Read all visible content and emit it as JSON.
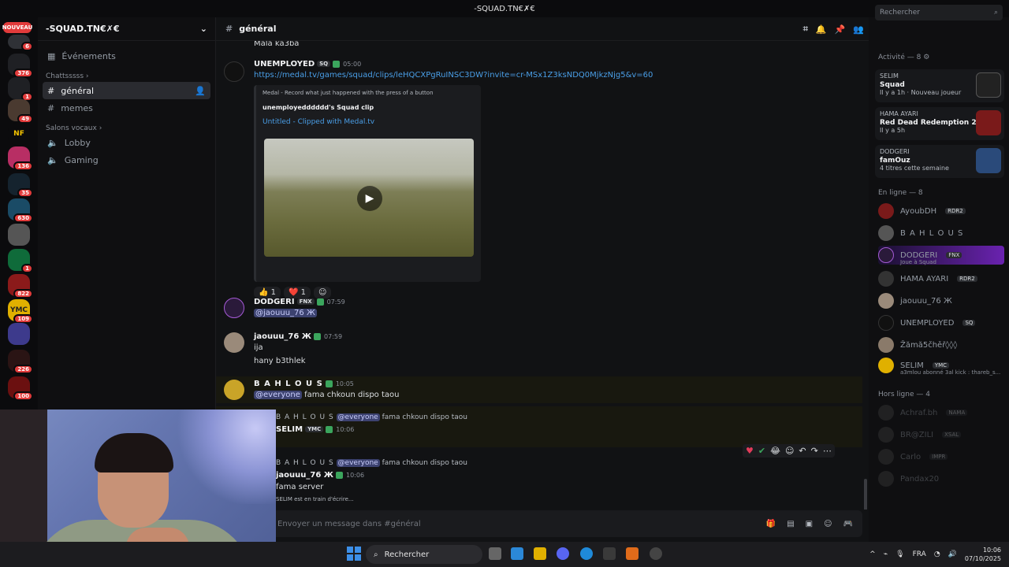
{
  "window": {
    "title": "-SQUAD.TN€✗€"
  },
  "servers": [
    {
      "badge": "NOUVEAU",
      "count": "6"
    },
    {
      "count": "376"
    },
    {
      "count": "1"
    },
    {
      "count": "49"
    },
    {
      "label": "NF"
    },
    {
      "count": "136"
    },
    {
      "count": "35"
    },
    {
      "count": "630"
    },
    {
      "count": "1"
    },
    {
      "count": "822"
    },
    {
      "label": "YMC",
      "count": "109"
    },
    {
      "count": ""
    },
    {
      "count": "226"
    },
    {
      "count": "100"
    }
  ],
  "channel_sidebar": {
    "server_name": "-SQUAD.TN€✗€",
    "events": "Événements",
    "cat_text": "Chattsssss",
    "text_channels": [
      "général",
      "memes"
    ],
    "cat_voice": "Salons vocaux",
    "voice_channels": [
      "Lobby",
      "Gaming"
    ]
  },
  "header": {
    "channel": "général",
    "search_placeholder": "Rechercher"
  },
  "messages": {
    "top_text": "Mala ka3ba",
    "m1": {
      "user": "UNEMPLOYED",
      "tag": "SQ",
      "time": "05:00",
      "link": "https://medal.tv/games/squad/clips/leHQCXPgRuINSC3DW?invite=cr-MSx1Z3ksNDQ0MjkzNjg5&v=60",
      "embed_site": "Medal - Record what just happened with the press of a button",
      "embed_title": "unemployedddddd's Squad clip",
      "embed_link": "Untitled - Clipped with Medal.tv",
      "react1": "👍 1",
      "react2": "❤️ 1"
    },
    "m2": {
      "user": "DODGERI",
      "tag": "FNX",
      "time": "07:59",
      "text": "@jaouuu_76 Ж"
    },
    "m3": {
      "user": "jaouuu_76 Ж",
      "time": "07:59",
      "l1": "ija",
      "l2": "hany b3thlek"
    },
    "m4": {
      "user": "B A H L O U S",
      "time": "10:05",
      "mention": "@everyone",
      "text": "fama chkoun dispo taou"
    },
    "m5": {
      "reply_user": "B A H L O U S",
      "reply_mention": "@everyone",
      "reply_text": "fama chkoun dispo taou",
      "user": "SELIM",
      "tag": "YMC",
      "time": "10:06"
    },
    "m6": {
      "reply_user": "B A H L O U S",
      "reply_mention": "@everyone",
      "reply_text": "fama chkoun dispo taou",
      "user": "jaouuu_76 Ж",
      "time": "10:06",
      "text": "fama server"
    },
    "typing": "SELIM est en train d'écrire..."
  },
  "composer": {
    "placeholder": "Envoyer un message dans #général"
  },
  "right": {
    "activity_head": "Activité — 8",
    "cards": [
      {
        "user": "SELIM",
        "title": "Squad",
        "sub": "Il y a 1h · Nouveau joueur"
      },
      {
        "user": "HAMA AYARI",
        "title": "Red Dead Redemption 2",
        "sub": "Il y a 5h"
      },
      {
        "user": "DODGERI",
        "title": "famOuz",
        "sub": "4 titres cette semaine"
      }
    ],
    "online_head": "En ligne — 8",
    "online": [
      {
        "name": "AyoubDH",
        "tag": "RDR2"
      },
      {
        "name": "B A H L O U S",
        "tag": ""
      },
      {
        "name": "DODGERI",
        "tag": "FNX",
        "sub": "Joue à Squad"
      },
      {
        "name": "HAMA AYARI",
        "tag": "RDR2"
      },
      {
        "name": "jaouuu_76 Ж",
        "tag": ""
      },
      {
        "name": "UNEMPLOYED",
        "tag": "SQ"
      },
      {
        "name": "Žămă5čhěř◊◊◊",
        "tag": ""
      },
      {
        "name": "SELIM",
        "tag": "YMC",
        "sub": "a3mlou abonné 3al kick : thareb_s..."
      }
    ],
    "offline_head": "Hors ligne — 4",
    "offline": [
      {
        "name": "Achraf.bh",
        "tag": "NAMA"
      },
      {
        "name": "BR@ZILI",
        "tag": "XSAL"
      },
      {
        "name": "Carlo",
        "tag": "IMPR"
      },
      {
        "name": "Pandax20",
        "tag": ""
      }
    ]
  },
  "taskbar": {
    "search": "Rechercher",
    "lang": "FRA",
    "time": "10:06",
    "date": "07/10/2025"
  }
}
